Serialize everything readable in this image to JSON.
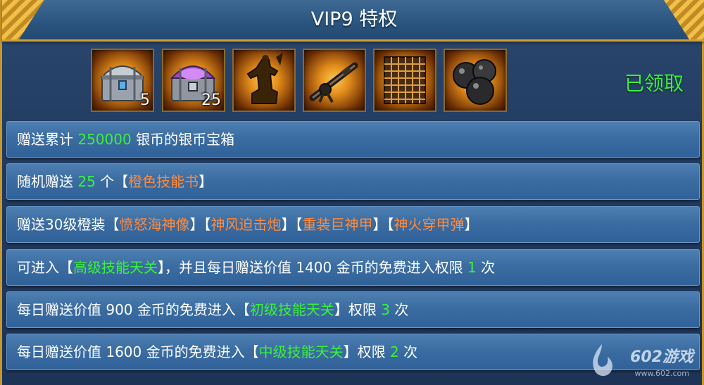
{
  "title": "VIP9 特权",
  "status": "已领取",
  "rewards": [
    {
      "icon": "silver-chest-icon",
      "count": "5"
    },
    {
      "icon": "purple-chest-icon",
      "count": "25"
    },
    {
      "icon": "statue-icon",
      "count": ""
    },
    {
      "icon": "cannon-icon",
      "count": ""
    },
    {
      "icon": "armor-icon",
      "count": ""
    },
    {
      "icon": "cannonballs-icon",
      "count": ""
    }
  ],
  "rows": [
    [
      {
        "t": "赠送累计 ",
        "c": "w"
      },
      {
        "t": "250000",
        "c": "g"
      },
      {
        "t": " 银币的银币宝箱",
        "c": "w"
      }
    ],
    [
      {
        "t": "随机赠送 ",
        "c": "w"
      },
      {
        "t": "25",
        "c": "g"
      },
      {
        "t": " 个【",
        "c": "w"
      },
      {
        "t": "橙色技能书",
        "c": "o"
      },
      {
        "t": "】",
        "c": "w"
      }
    ],
    [
      {
        "t": "赠送30级橙装【",
        "c": "w"
      },
      {
        "t": "愤怒海神像",
        "c": "o"
      },
      {
        "t": "】【",
        "c": "w"
      },
      {
        "t": "神风迫击炮",
        "c": "o"
      },
      {
        "t": "】【",
        "c": "w"
      },
      {
        "t": "重装巨神甲",
        "c": "o"
      },
      {
        "t": "】【",
        "c": "w"
      },
      {
        "t": "神火穿甲弹",
        "c": "o"
      },
      {
        "t": "】",
        "c": "w"
      }
    ],
    [
      {
        "t": "可进入【",
        "c": "w"
      },
      {
        "t": "高级技能天关",
        "c": "g"
      },
      {
        "t": "】，并且每日赠送价值 1400 金币的免费进入权限 ",
        "c": "w"
      },
      {
        "t": "1",
        "c": "g"
      },
      {
        "t": " 次",
        "c": "w"
      }
    ],
    [
      {
        "t": "每日赠送价值 900 金币的免费进入【",
        "c": "w"
      },
      {
        "t": "初级技能天关",
        "c": "g"
      },
      {
        "t": "】权限 ",
        "c": "w"
      },
      {
        "t": "3",
        "c": "g"
      },
      {
        "t": " 次",
        "c": "w"
      }
    ],
    [
      {
        "t": "每日赠送价值 1600 金币的免费进入【",
        "c": "w"
      },
      {
        "t": "中级技能天关",
        "c": "g"
      },
      {
        "t": "】权限 ",
        "c": "w"
      },
      {
        "t": "2",
        "c": "g"
      },
      {
        "t": " 次",
        "c": "w"
      }
    ]
  ],
  "watermark": {
    "text": "602游戏",
    "url": "www.602.com"
  },
  "colors": {
    "highlight_green": "#3cf03a",
    "highlight_orange": "#ff8a3c",
    "row_blue": "#3b6da2",
    "gold_border": "#d2a23a"
  }
}
